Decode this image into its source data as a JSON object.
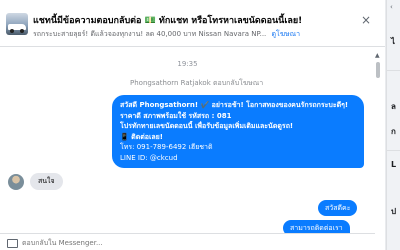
{
  "header": {
    "title": "แชทนี้มีข้อความตอบกลับต่อ 💵 ทักแชท หรือโทรหาเลขนัดดอนนี้เลย!",
    "subtitle": "รถกระบะสายลุยร์! ดีแล้วจองทุกงาน! ลด 40,000 บาท Nissan Navara NP...",
    "subtitle_link": "ดูโฆษณา",
    "close_icon": "×"
  },
  "chat": {
    "timestamp": "19:35",
    "sender_note": "Phongsathorn Ratjakok ตอบกลับโฆษณา",
    "outgoing_lines": [
      "สวัสดี Phongsathorn! ✔️ อย่ารอช้า! โอกาสทองของคนรักรถกระบะดีๆ!",
      "ราคาดี สภาพพร้อมใช้ รหัสรถ : 081",
      "โปรทักทายเลขนัดดอนนี้ เพื่อรับข้อมูลเพิ่มเติมและนัดดูรถ!",
      "📱 ติดต่อเลย!",
      "โทร: 091-789-6492 เฮียชาติ",
      "LINE ID: @ckcud"
    ],
    "incoming_text": "สนใจ",
    "outgoing_short": "สวัสดีคะ",
    "outgoing_partial": "สามารถติดต่อเรา"
  },
  "composer": {
    "placeholder": "ตอบกลับใน Messenger..."
  },
  "side_panel": {
    "chevron": "‹",
    "letters": [
      "ไ",
      "ล",
      "ก",
      "L",
      "ป"
    ]
  },
  "scrollbar": {
    "up_arrow": "▲"
  }
}
